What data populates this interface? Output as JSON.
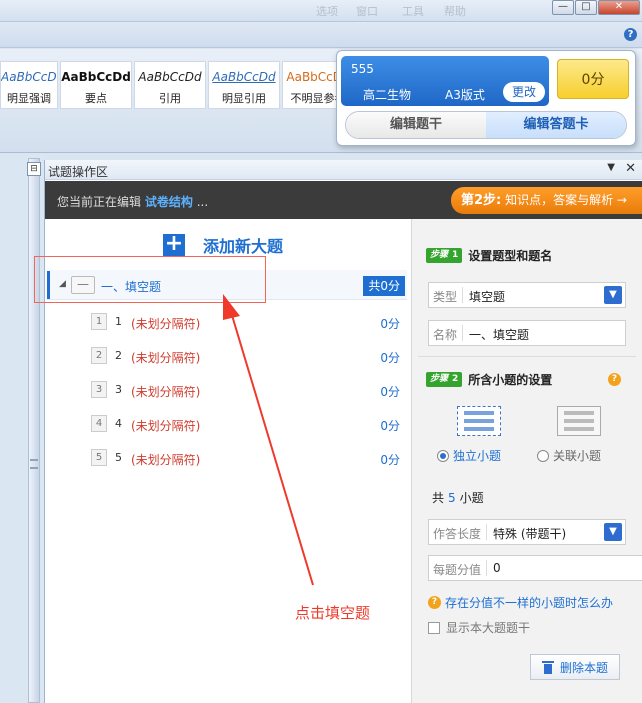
{
  "window": {
    "ghost_tabs": [
      "选项",
      "窗口",
      "工具",
      "帮助"
    ],
    "min_label": "—",
    "max_label": "□",
    "close_label": "✕",
    "help_label": "?"
  },
  "style_gallery": [
    {
      "sample": "AaBbCcDd",
      "name": "明显强调"
    },
    {
      "sample": "AaBbCcDd",
      "name": "要点"
    },
    {
      "sample": "AaBbCcDd",
      "name": "引用"
    },
    {
      "sample": "AaBbCcDd",
      "name": "明显引用"
    },
    {
      "sample": "AaBbCcDd",
      "name": "不明显参考"
    }
  ],
  "popup": {
    "paper_number": "555",
    "subject": "高二生物",
    "layout": "A3版式",
    "change_button": "更改",
    "score": "0分",
    "tabs": [
      "编辑题干",
      "编辑答题卡"
    ],
    "active_tab_index": 1
  },
  "panel": {
    "title": "试题操作区",
    "dropdown_icon": "▼",
    "close_icon": "✕",
    "editing_prefix": "您当前正在编辑",
    "editing_target": "试卷结构",
    "editing_suffix": "...",
    "step2_button": {
      "step": "第2步:",
      "text": "知识点，答案与解析 →"
    },
    "add_section_label": "添加新大题",
    "section": {
      "name": "一、填空题",
      "total": "共0分"
    },
    "questions": [
      {
        "badge": "1",
        "index": "1",
        "text": "(未划分隔符)",
        "score": "0分"
      },
      {
        "badge": "2",
        "index": "2",
        "text": "(未划分隔符)",
        "score": "0分"
      },
      {
        "badge": "3",
        "index": "3",
        "text": "(未划分隔符)",
        "score": "0分"
      },
      {
        "badge": "4",
        "index": "4",
        "text": "(未划分隔符)",
        "score": "0分"
      },
      {
        "badge": "5",
        "index": "5",
        "text": "(未划分隔符)",
        "score": "0分"
      }
    ],
    "annotation": "点击填空题"
  },
  "settings": {
    "step1": {
      "badge": "步骤",
      "num": "1",
      "title": "设置题型和题名"
    },
    "type_label": "类型",
    "type_value": "填空题",
    "name_label": "名称",
    "name_value": "一、填空题",
    "step2": {
      "badge": "步骤",
      "num": "2",
      "title": "所含小题的设置"
    },
    "mode_options": [
      {
        "label": "独立小题",
        "selected": true
      },
      {
        "label": "关联小题",
        "selected": false
      }
    ],
    "count_prefix": "共",
    "count_value": "5",
    "count_suffix": "小题",
    "answer_length_label": "作答长度",
    "answer_length_value": "特殊 (带题干)",
    "score_label": "每题分值",
    "score_value": "0",
    "warn_link": "存在分值不一样的小题时怎么办",
    "show_stem_label": "显示本大题题干",
    "delete_button": "删除本题"
  },
  "colors": {
    "accent": "#1e6fd1",
    "step_badge": "#35a42e",
    "step2_orange": "#ea7b0a",
    "annotation_red": "#ef3a2b",
    "unsplit_red": "#d03b2d"
  }
}
